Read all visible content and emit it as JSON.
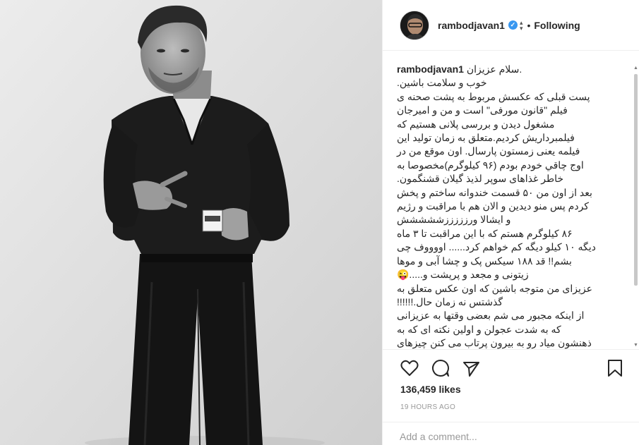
{
  "post": {
    "username": "rambodjavan1",
    "follow_separator": "•",
    "follow_status": "Following",
    "caption_user": "rambodjavan1",
    "caption_lines": [
      "سلام عزیزان.",
      "خوب و سلامت باشین.",
      "پست قبلی که عکسش مربوط به پشت صحنه ی",
      "فیلم \"قانون مورفی\" است و من و امیرجان",
      "مشغول دیدن و بررسی پلانی هستیم که",
      "فیلمبرداریش کردیم.متعلق به زمان تولید این",
      "فیلمه یعنی زمستون پارسال. اون موقع من در",
      "اوج چاقي خودم بودم (۹۶ کیلوگرم)مخصوصا به",
      "خاطر غذاهای سوپر لذیذ گیلان قشنگمون.",
      "بعد از اون من ۵۰ قسمت خندوانه ساختم و پخش",
      "کردم پس منو دیدین و الان هم با مراقبت و رژیم",
      "و ایشالا ورزززززششششش",
      "۸۶ کیلوگرم هستم که با این مراقبت تا ۳ ماه",
      "دیگه ۱۰ کیلو دیگه کم خواهم کرد...... اووووف چی",
      "بشم!! قد ۱۸۸ سیکس پک و چشا آبی و موها",
      "زیتونی و مجعد و پرپشت و.....😜",
      "عزیزای من متوجه باشین که اون عکس متعلق به",
      "گذشتس نه زمان حال.!!!!!!",
      "از اینکه مجبور می شم بعضی وقتها به عزیزانی",
      "که به شدت عجولن و اولین نکته ای که به",
      "ذهنشون میاد رو به بیرون پرتاب می کنن چیزهای"
    ],
    "likes": "136,459 likes",
    "timestamp": "19 HOURS AGO",
    "comment_placeholder": "Add a comment..."
  },
  "icons": {
    "verified": "verified-badge-icon",
    "like": "heart-icon",
    "comment": "comment-icon",
    "share": "share-icon",
    "save": "bookmark-icon"
  },
  "colors": {
    "verified_badge": "#3897f0",
    "text": "#262626",
    "muted": "#999999",
    "border": "#efefef"
  }
}
